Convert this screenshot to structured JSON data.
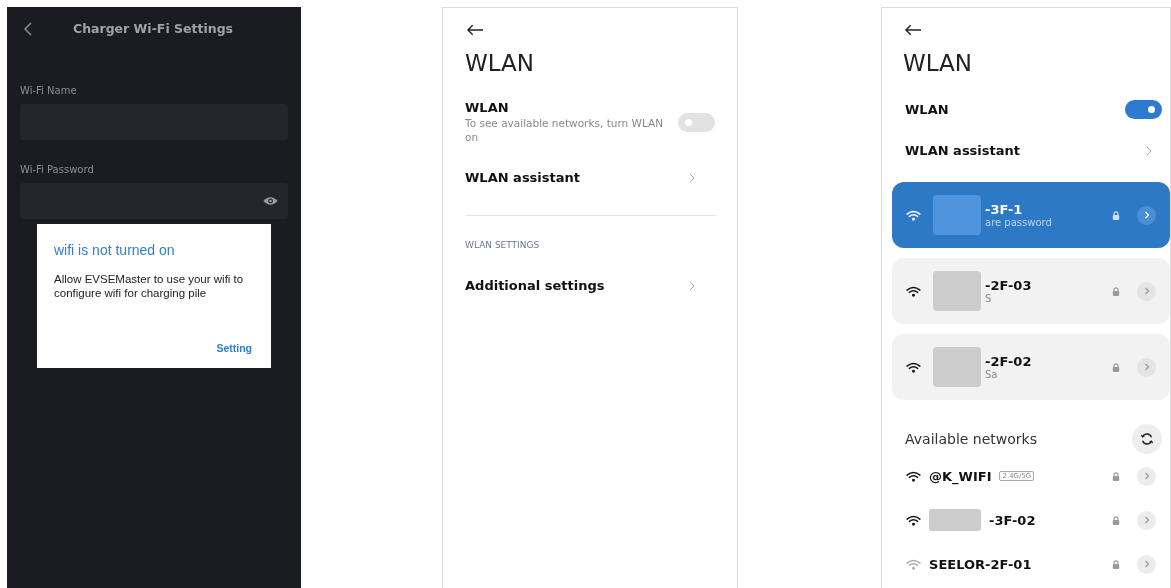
{
  "charger_screen": {
    "title": "Charger Wi-Fi Settings",
    "fields": [
      {
        "label": "Wi-Fi Name",
        "kind": "text"
      },
      {
        "label": "Wi-Fi Password",
        "kind": "password"
      }
    ],
    "dialog": {
      "title": "wifi is not turned on",
      "message": "Allow EVSEMaster to use your wifi to configure wifi for charging pile",
      "button": "Setting"
    }
  },
  "wlan_off_screen": {
    "title": "WLAN",
    "toggle": {
      "label": "WLAN",
      "description": "To see available networks, turn WLAN on",
      "on": false
    },
    "items": [
      {
        "label": "WLAN assistant"
      }
    ],
    "section_header": "WLAN SETTINGS",
    "section_items": [
      {
        "label": "Additional settings"
      }
    ]
  },
  "wlan_on_screen": {
    "title": "WLAN",
    "toggle": {
      "label": "WLAN",
      "on": true
    },
    "items": [
      {
        "label": "WLAN assistant"
      }
    ],
    "saved_networks": [
      {
        "name": "-3F-1",
        "subtitle": "are password",
        "selected": true
      },
      {
        "name": "-2F-03",
        "subtitle": "S",
        "selected": false
      },
      {
        "name": "-2F-02",
        "subtitle": "Sa",
        "selected": false
      }
    ],
    "available_header": "Available networks",
    "available_networks": [
      {
        "name": "@K_WIFI",
        "badge": "2.4G/5G",
        "blurred": false,
        "weak": false
      },
      {
        "name": "-3F-02",
        "blurred": true,
        "weak": false
      },
      {
        "name": "SEELOR-2F-01",
        "blurred": false,
        "weak": true
      }
    ]
  }
}
